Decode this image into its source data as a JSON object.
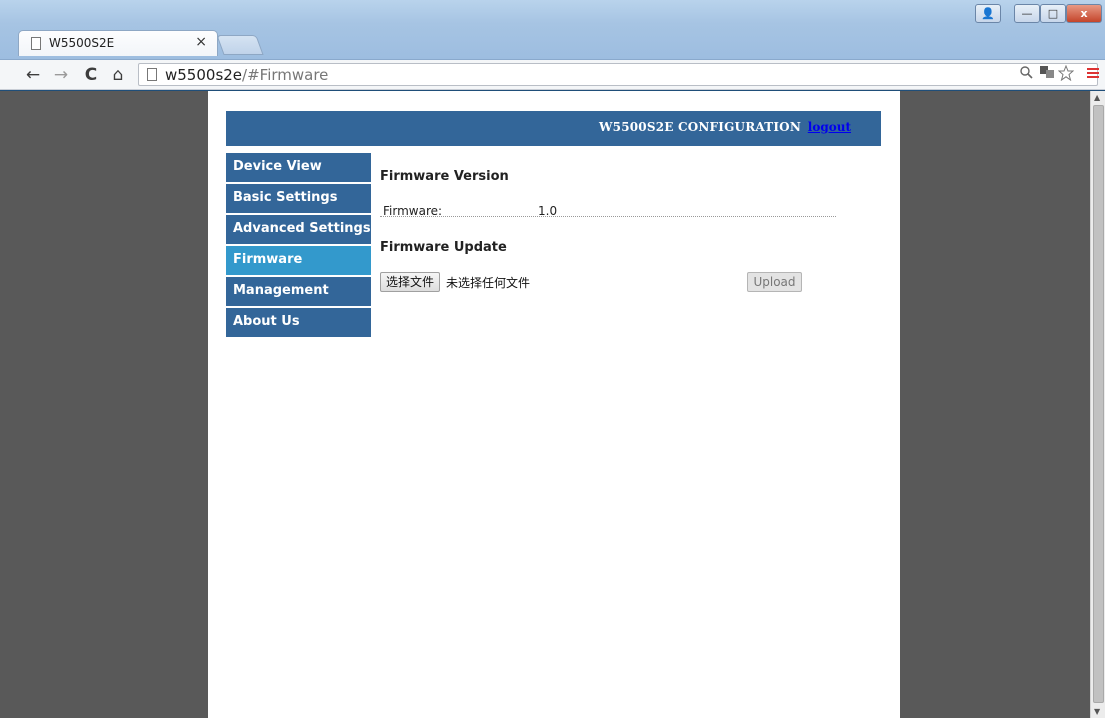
{
  "browser": {
    "tab": {
      "title": "W5500S2E",
      "close": "×"
    },
    "window_controls": {
      "user": "👤",
      "minimize": "—",
      "maximize": "□",
      "close": "x"
    },
    "nav": {
      "back": "←",
      "forward": "→",
      "reload": "C",
      "home": "⌂"
    },
    "address": {
      "host": "w5500s2e",
      "path": "/#Firmware"
    },
    "toolbar_icons": [
      "zoom-icon",
      "translate-icon",
      "star-icon",
      "menu-icon"
    ]
  },
  "header": {
    "title": "W5500S2E CONFIGURATION",
    "logout": "logout"
  },
  "sidebar": {
    "items": [
      {
        "label": "Device View",
        "active": false
      },
      {
        "label": "Basic Settings",
        "active": false
      },
      {
        "label": "Advanced Settings",
        "active": false
      },
      {
        "label": "Firmware",
        "active": true
      },
      {
        "label": "Management",
        "active": false
      },
      {
        "label": "About Us",
        "active": false
      }
    ]
  },
  "main": {
    "version_title": "Firmware Version",
    "firmware_label": "Firmware:",
    "firmware_value": "1.0",
    "update_title": "Firmware Update",
    "choose_file_label": "选择文件",
    "no_file_text": "未选择任何文件",
    "upload_label": "Upload"
  },
  "colors": {
    "header_bg": "#336699",
    "nav_bg": "#336699",
    "nav_active_bg": "#3399cc",
    "viewport_bg": "#595959"
  }
}
